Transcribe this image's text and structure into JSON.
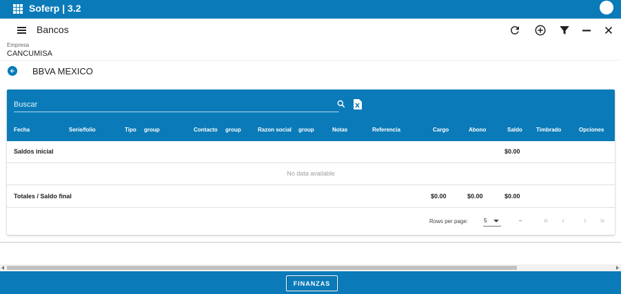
{
  "app": {
    "title": "Soferp | 3.2"
  },
  "toolbar": {
    "title": "Bancos"
  },
  "empresa": {
    "label": "Empresa",
    "value": "CANCUMISA"
  },
  "bank": {
    "name": "BBVA MEXICO"
  },
  "search": {
    "placeholder": "Buscar"
  },
  "table": {
    "columns": [
      "Fecha",
      "Serie/folio",
      "Tipo",
      "group",
      "Contacto",
      "group",
      "Razon social",
      "group",
      "Notas",
      "Referencia",
      "Cargo",
      "Abono",
      "Saldo",
      "Timbrado",
      "Opciones"
    ],
    "saldos_inicial": {
      "label": "Saldos inicial",
      "saldo": "$0.00"
    },
    "no_data": "No data available",
    "totales": {
      "label": "Totales / Saldo final",
      "cargo": "$0.00",
      "abono": "$0.00",
      "saldo": "$0.00"
    }
  },
  "pagination": {
    "rows_per_page_label": "Rows per page:",
    "rows_per_page": "5",
    "range": "–"
  },
  "bottom": {
    "button_label": "FINANZAS"
  },
  "colors": {
    "primary": "#0a7bb8"
  },
  "icons": [
    "apps-icon",
    "menu-icon",
    "refresh-icon",
    "add-circle-icon",
    "filter-icon",
    "minimize-icon",
    "close-icon",
    "back-arrow-icon",
    "search-icon",
    "excel-export-icon",
    "first-page-icon",
    "prev-page-icon",
    "next-page-icon",
    "last-page-icon"
  ]
}
